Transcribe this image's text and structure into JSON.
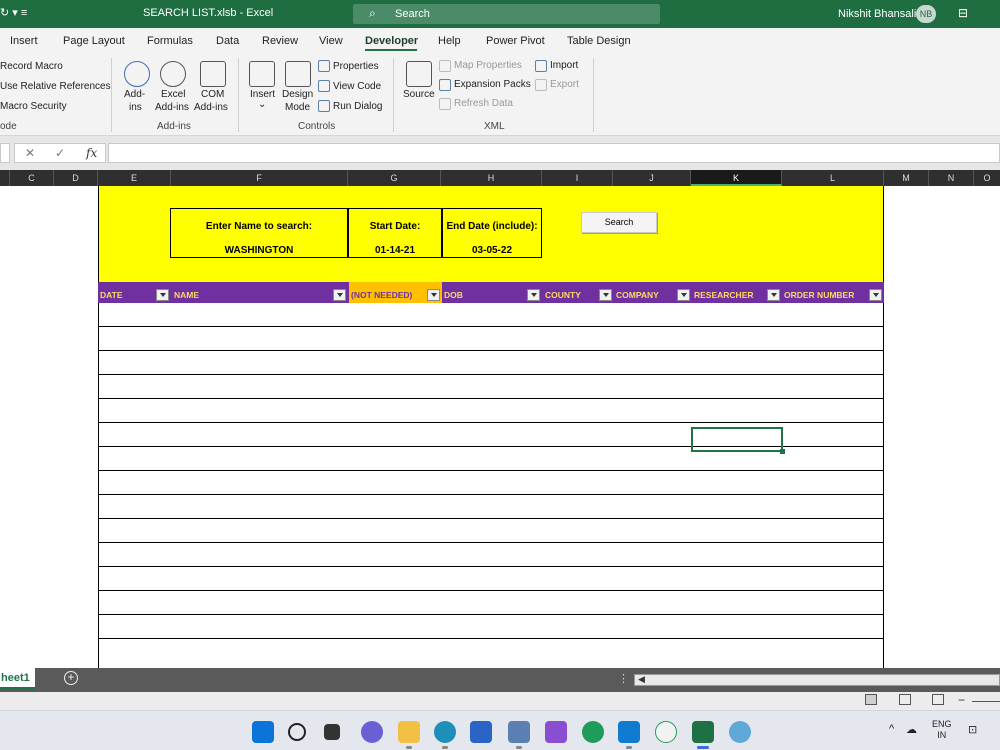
{
  "titlebar": {
    "quick_access": "↻ ▾ ≡",
    "title": "SEARCH LIST.xlsb  -  Excel",
    "search_placeholder": "Search",
    "user_name": "Nikshit Bhansali",
    "user_initials": "NB",
    "accent": "#1e6e42"
  },
  "ribbon": {
    "tabs": [
      "Insert",
      "Page Layout",
      "Formulas",
      "Data",
      "Review",
      "View",
      "Developer",
      "Help",
      "Power Pivot",
      "Table Design"
    ],
    "active_tab": "Developer",
    "code": {
      "record_macro": "Record Macro",
      "relative_refs": "Use Relative References",
      "macro_security": "Macro Security",
      "group": "ode"
    },
    "addins": {
      "addins_1": "Add-",
      "addins_2": "ins",
      "excel_1": "Excel",
      "excel_2": "Add-ins",
      "com_1": "COM",
      "com_2": "Add-ins",
      "group": "Add-ins"
    },
    "controls": {
      "insert": "Insert",
      "insert_caret": "⌄",
      "design_1": "Design",
      "design_2": "Mode",
      "properties": "Properties",
      "view_code": "View Code",
      "run_dialog": "Run Dialog",
      "group": "Controls"
    },
    "xml": {
      "source": "Source",
      "map_properties": "Map Properties",
      "expansion_packs": "Expansion Packs",
      "refresh_data": "Refresh Data",
      "import": "Import",
      "export": "Export",
      "group": "XML"
    }
  },
  "formula_bar": {
    "cancel": "✕",
    "enter": "✓",
    "fx": "fx",
    "value": ""
  },
  "columns": [
    "C",
    "D",
    "E",
    "F",
    "G",
    "H",
    "I",
    "J",
    "K",
    "L",
    "M",
    "N",
    "O"
  ],
  "selected_column": "K",
  "search_panel": {
    "name_label": "Enter Name to search:",
    "name_value": "WASHINGTON",
    "start_label": "Start Date:",
    "start_value": "01-14-21",
    "end_label": "End Date (include):",
    "end_value": "03-05-22",
    "button": "Search"
  },
  "table_headers": [
    "DATE",
    "NAME",
    "(NOT NEEDED)",
    "DOB",
    "COUNTY",
    "COMPANY",
    "RESEARCHER",
    "ORDER NUMBER"
  ],
  "sheet": {
    "tab": "heet1",
    "add": "+",
    "scroll_dots": "⋮",
    "scroll_left": "◀"
  },
  "taskbar": {
    "tray_caret": "^",
    "lang_1": "ENG",
    "lang_2": "IN"
  }
}
